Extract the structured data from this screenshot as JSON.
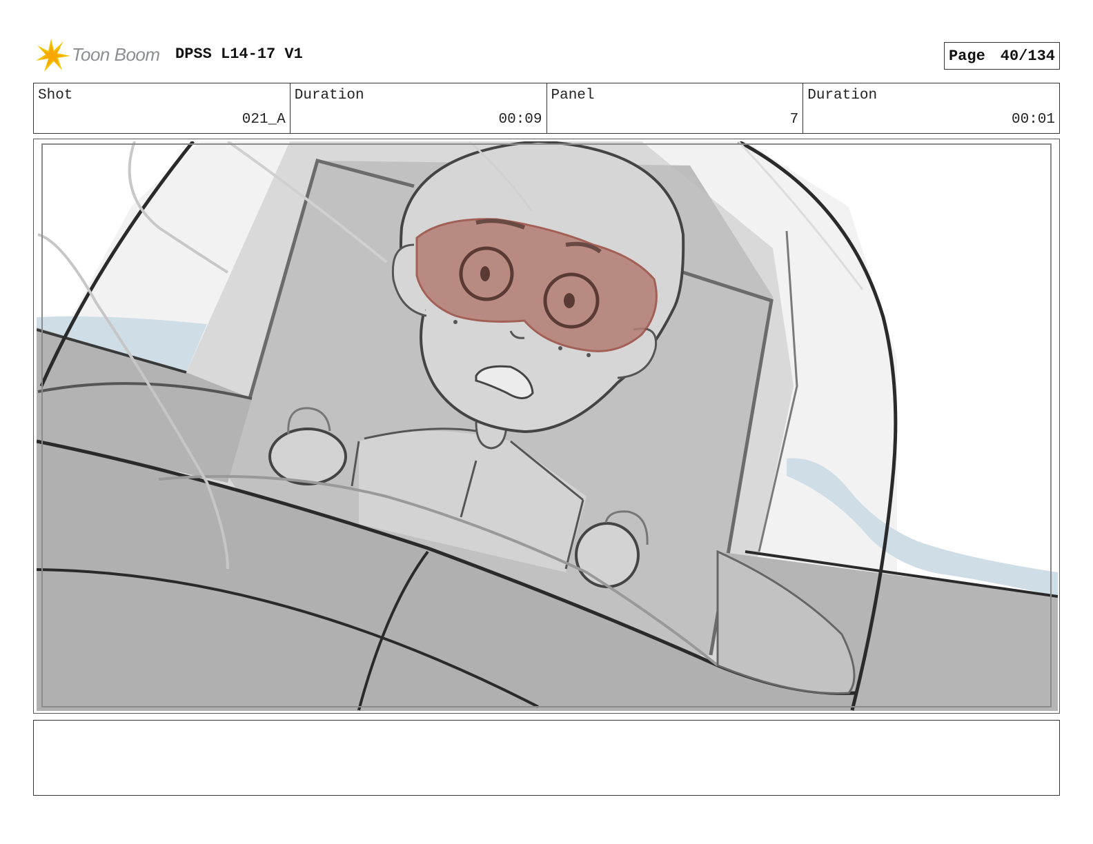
{
  "header": {
    "logo_text": "Toon Boom",
    "title": "DPSS L14-17 V1",
    "page_label": "Page",
    "page_value": "40/134"
  },
  "info": {
    "shot_label": "Shot",
    "shot_value": "021_A",
    "shot_duration_label": "Duration",
    "shot_duration_value": "00:09",
    "panel_label": "Panel",
    "panel_value": "7",
    "panel_duration_label": "Duration",
    "panel_duration_value": "00:01"
  },
  "colors": {
    "goggles": "#b57d74",
    "sky_water": "#cfdde6",
    "ink": "#2a2a2a",
    "logo_burst": "#f5c400"
  },
  "notes": {
    "text": ""
  }
}
